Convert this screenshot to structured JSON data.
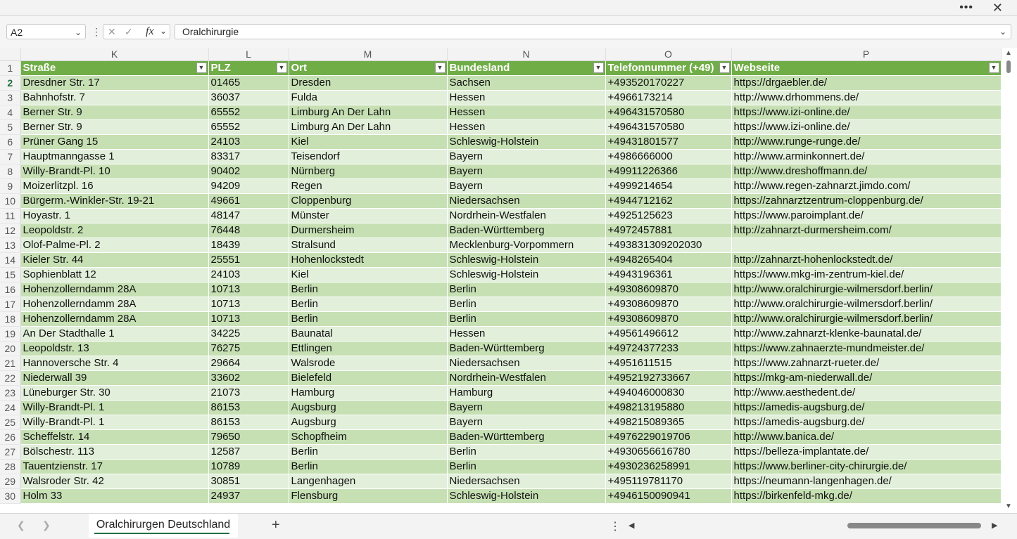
{
  "window": {
    "more_label": "•••",
    "close_label": "✕"
  },
  "formula_bar": {
    "name_box": "A2",
    "content": "Oralchirurgie",
    "cancel_icon": "✕",
    "enter_icon": "✓",
    "fx_label": "fx",
    "chevron": "⌄"
  },
  "columns": [
    "K",
    "L",
    "M",
    "N",
    "O",
    "P"
  ],
  "headers": [
    "Straße",
    "PLZ",
    "Ort",
    "Bundesland",
    "Telefonnummer (+49)",
    "Webseite"
  ],
  "rows": [
    [
      "2",
      "Dresdner Str. 17",
      "01465",
      "Dresden",
      "Sachsen",
      "+493520170227",
      "https://drgaebler.de/"
    ],
    [
      "3",
      "Bahnhofstr. 7",
      "36037",
      "Fulda",
      "Hessen",
      "+4966173214",
      "http://www.drhommens.de/"
    ],
    [
      "4",
      "Berner Str. 9",
      "65552",
      "Limburg An Der Lahn",
      "Hessen",
      "+496431570580",
      "https://www.izi-online.de/"
    ],
    [
      "5",
      "Berner Str. 9",
      "65552",
      "Limburg An Der Lahn",
      "Hessen",
      "+496431570580",
      "https://www.izi-online.de/"
    ],
    [
      "6",
      "Prüner Gang 15",
      "24103",
      "Kiel",
      "Schleswig-Holstein",
      "+49431801577",
      "http://www.runge-runge.de/"
    ],
    [
      "7",
      "Hauptmanngasse 1",
      "83317",
      "Teisendorf",
      "Bayern",
      "+4986666000",
      "http://www.arminkonnert.de/"
    ],
    [
      "8",
      "Willy-Brandt-Pl. 10",
      "90402",
      "Nürnberg",
      "Bayern",
      "+49911226366",
      "http://www.dreshoffmann.de/"
    ],
    [
      "9",
      "Moizerlitzpl. 16",
      "94209",
      "Regen",
      "Bayern",
      "+4999214654",
      "http://www.regen-zahnarzt.jimdo.com/"
    ],
    [
      "10",
      "Bürgerm.-Winkler-Str. 19-21",
      "49661",
      "Cloppenburg",
      "Niedersachsen",
      "+4944712162",
      "https://zahnarztzentrum-cloppenburg.de/"
    ],
    [
      "11",
      "Hoyastr. 1",
      "48147",
      "Münster",
      "Nordrhein-Westfalen",
      "+4925125623",
      "https://www.paroimplant.de/"
    ],
    [
      "12",
      "Leopoldstr. 2",
      "76448",
      "Durmersheim",
      "Baden-Württemberg",
      "+4972457881",
      "http://zahnarzt-durmersheim.com/"
    ],
    [
      "13",
      "Olof-Palme-Pl. 2",
      "18439",
      "Stralsund",
      "Mecklenburg-Vorpommern",
      "+493831309202030",
      ""
    ],
    [
      "14",
      "Kieler Str. 44",
      "25551",
      "Hohenlockstedt",
      "Schleswig-Holstein",
      "+4948265404",
      "http://zahnarzt-hohenlockstedt.de/"
    ],
    [
      "15",
      "Sophienblatt 12",
      "24103",
      "Kiel",
      "Schleswig-Holstein",
      "+4943196361",
      "https://www.mkg-im-zentrum-kiel.de/"
    ],
    [
      "16",
      "Hohenzollerndamm 28A",
      "10713",
      "Berlin",
      "Berlin",
      "+49308609870",
      "http://www.oralchirurgie-wilmersdorf.berlin/"
    ],
    [
      "17",
      "Hohenzollerndamm 28A",
      "10713",
      "Berlin",
      "Berlin",
      "+49308609870",
      "http://www.oralchirurgie-wilmersdorf.berlin/"
    ],
    [
      "18",
      "Hohenzollerndamm 28A",
      "10713",
      "Berlin",
      "Berlin",
      "+49308609870",
      "http://www.oralchirurgie-wilmersdorf.berlin/"
    ],
    [
      "19",
      "An Der Stadthalle 1",
      "34225",
      "Baunatal",
      "Hessen",
      "+49561496612",
      "http://www.zahnarzt-klenke-baunatal.de/"
    ],
    [
      "20",
      "Leopoldstr. 13",
      "76275",
      "Ettlingen",
      "Baden-Württemberg",
      "+49724377233",
      "https://www.zahnaerzte-mundmeister.de/"
    ],
    [
      "21",
      "Hannoversche Str. 4",
      "29664",
      "Walsrode",
      "Niedersachsen",
      "+4951611515",
      "https://www.zahnarzt-rueter.de/"
    ],
    [
      "22",
      "Niederwall 39",
      "33602",
      "Bielefeld",
      "Nordrhein-Westfalen",
      "+4952192733667",
      "https://mkg-am-niederwall.de/"
    ],
    [
      "23",
      "Lüneburger Str. 30",
      "21073",
      "Hamburg",
      "Hamburg",
      "+494046000830",
      "http://www.aesthedent.de/"
    ],
    [
      "24",
      "Willy-Brandt-Pl. 1",
      "86153",
      "Augsburg",
      "Bayern",
      "+498213195880",
      "https://amedis-augsburg.de/"
    ],
    [
      "25",
      "Willy-Brandt-Pl. 1",
      "86153",
      "Augsburg",
      "Bayern",
      "+498215089365",
      "https://amedis-augsburg.de/"
    ],
    [
      "26",
      "Scheffelstr. 14",
      "79650",
      "Schopfheim",
      "Baden-Württemberg",
      "+4976229019706",
      "http://www.banica.de/"
    ],
    [
      "27",
      "Bölschestr. 113",
      "12587",
      "Berlin",
      "Berlin",
      "+4930656616780",
      "https://belleza-implantate.de/"
    ],
    [
      "28",
      "Tauentzienstr. 17",
      "10789",
      "Berlin",
      "Berlin",
      "+4930236258991",
      "https://www.berliner-city-chirurgie.de/"
    ],
    [
      "29",
      "Walsroder Str. 42",
      "30851",
      "Langenhagen",
      "Niedersachsen",
      "+495119781170",
      "https://neumann-langenhagen.de/"
    ],
    [
      "30",
      "Holm 33",
      "24937",
      "Flensburg",
      "Schleswig-Holstein",
      "+4946150090941",
      "https://birkenfeld-mkg.de/"
    ]
  ],
  "sheet_tabs": {
    "active": "Oralchirurgen Deutschland",
    "add_label": "+"
  }
}
